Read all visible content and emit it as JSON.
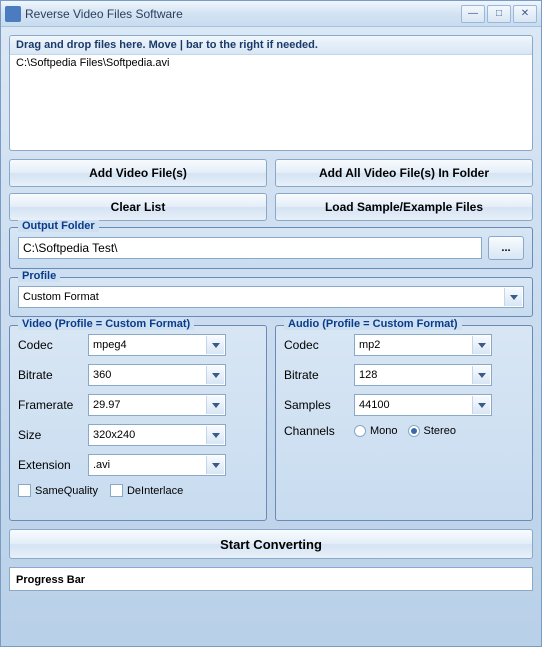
{
  "window": {
    "title": "Reverse Video Files Software"
  },
  "fileDrop": {
    "header": "Drag and drop files here. Move | bar to the right if needed.",
    "items": [
      "C:\\Softpedia Files\\Softpedia.avi"
    ]
  },
  "buttons": {
    "addFiles": "Add Video File(s)",
    "addFolder": "Add All Video File(s) In Folder",
    "clearList": "Clear List",
    "loadSample": "Load Sample/Example Files",
    "browse": "...",
    "start": "Start Converting"
  },
  "outputFolder": {
    "legend": "Output Folder",
    "value": "C:\\Softpedia Test\\"
  },
  "profile": {
    "legend": "Profile",
    "value": "Custom Format"
  },
  "video": {
    "legend": "Video (Profile = Custom Format)",
    "codecLabel": "Codec",
    "codec": "mpeg4",
    "bitrateLabel": "Bitrate",
    "bitrate": "360",
    "framerateLabel": "Framerate",
    "framerate": "29.97",
    "sizeLabel": "Size",
    "size": "320x240",
    "extensionLabel": "Extension",
    "extension": ".avi",
    "sameQuality": "SameQuality",
    "deinterlace": "DeInterlace"
  },
  "audio": {
    "legend": "Audio (Profile = Custom Format)",
    "codecLabel": "Codec",
    "codec": "mp2",
    "bitrateLabel": "Bitrate",
    "bitrate": "128",
    "samplesLabel": "Samples",
    "samples": "44100",
    "channelsLabel": "Channels",
    "mono": "Mono",
    "stereo": "Stereo",
    "channelsValue": "stereo"
  },
  "progress": {
    "text": "Progress Bar"
  }
}
